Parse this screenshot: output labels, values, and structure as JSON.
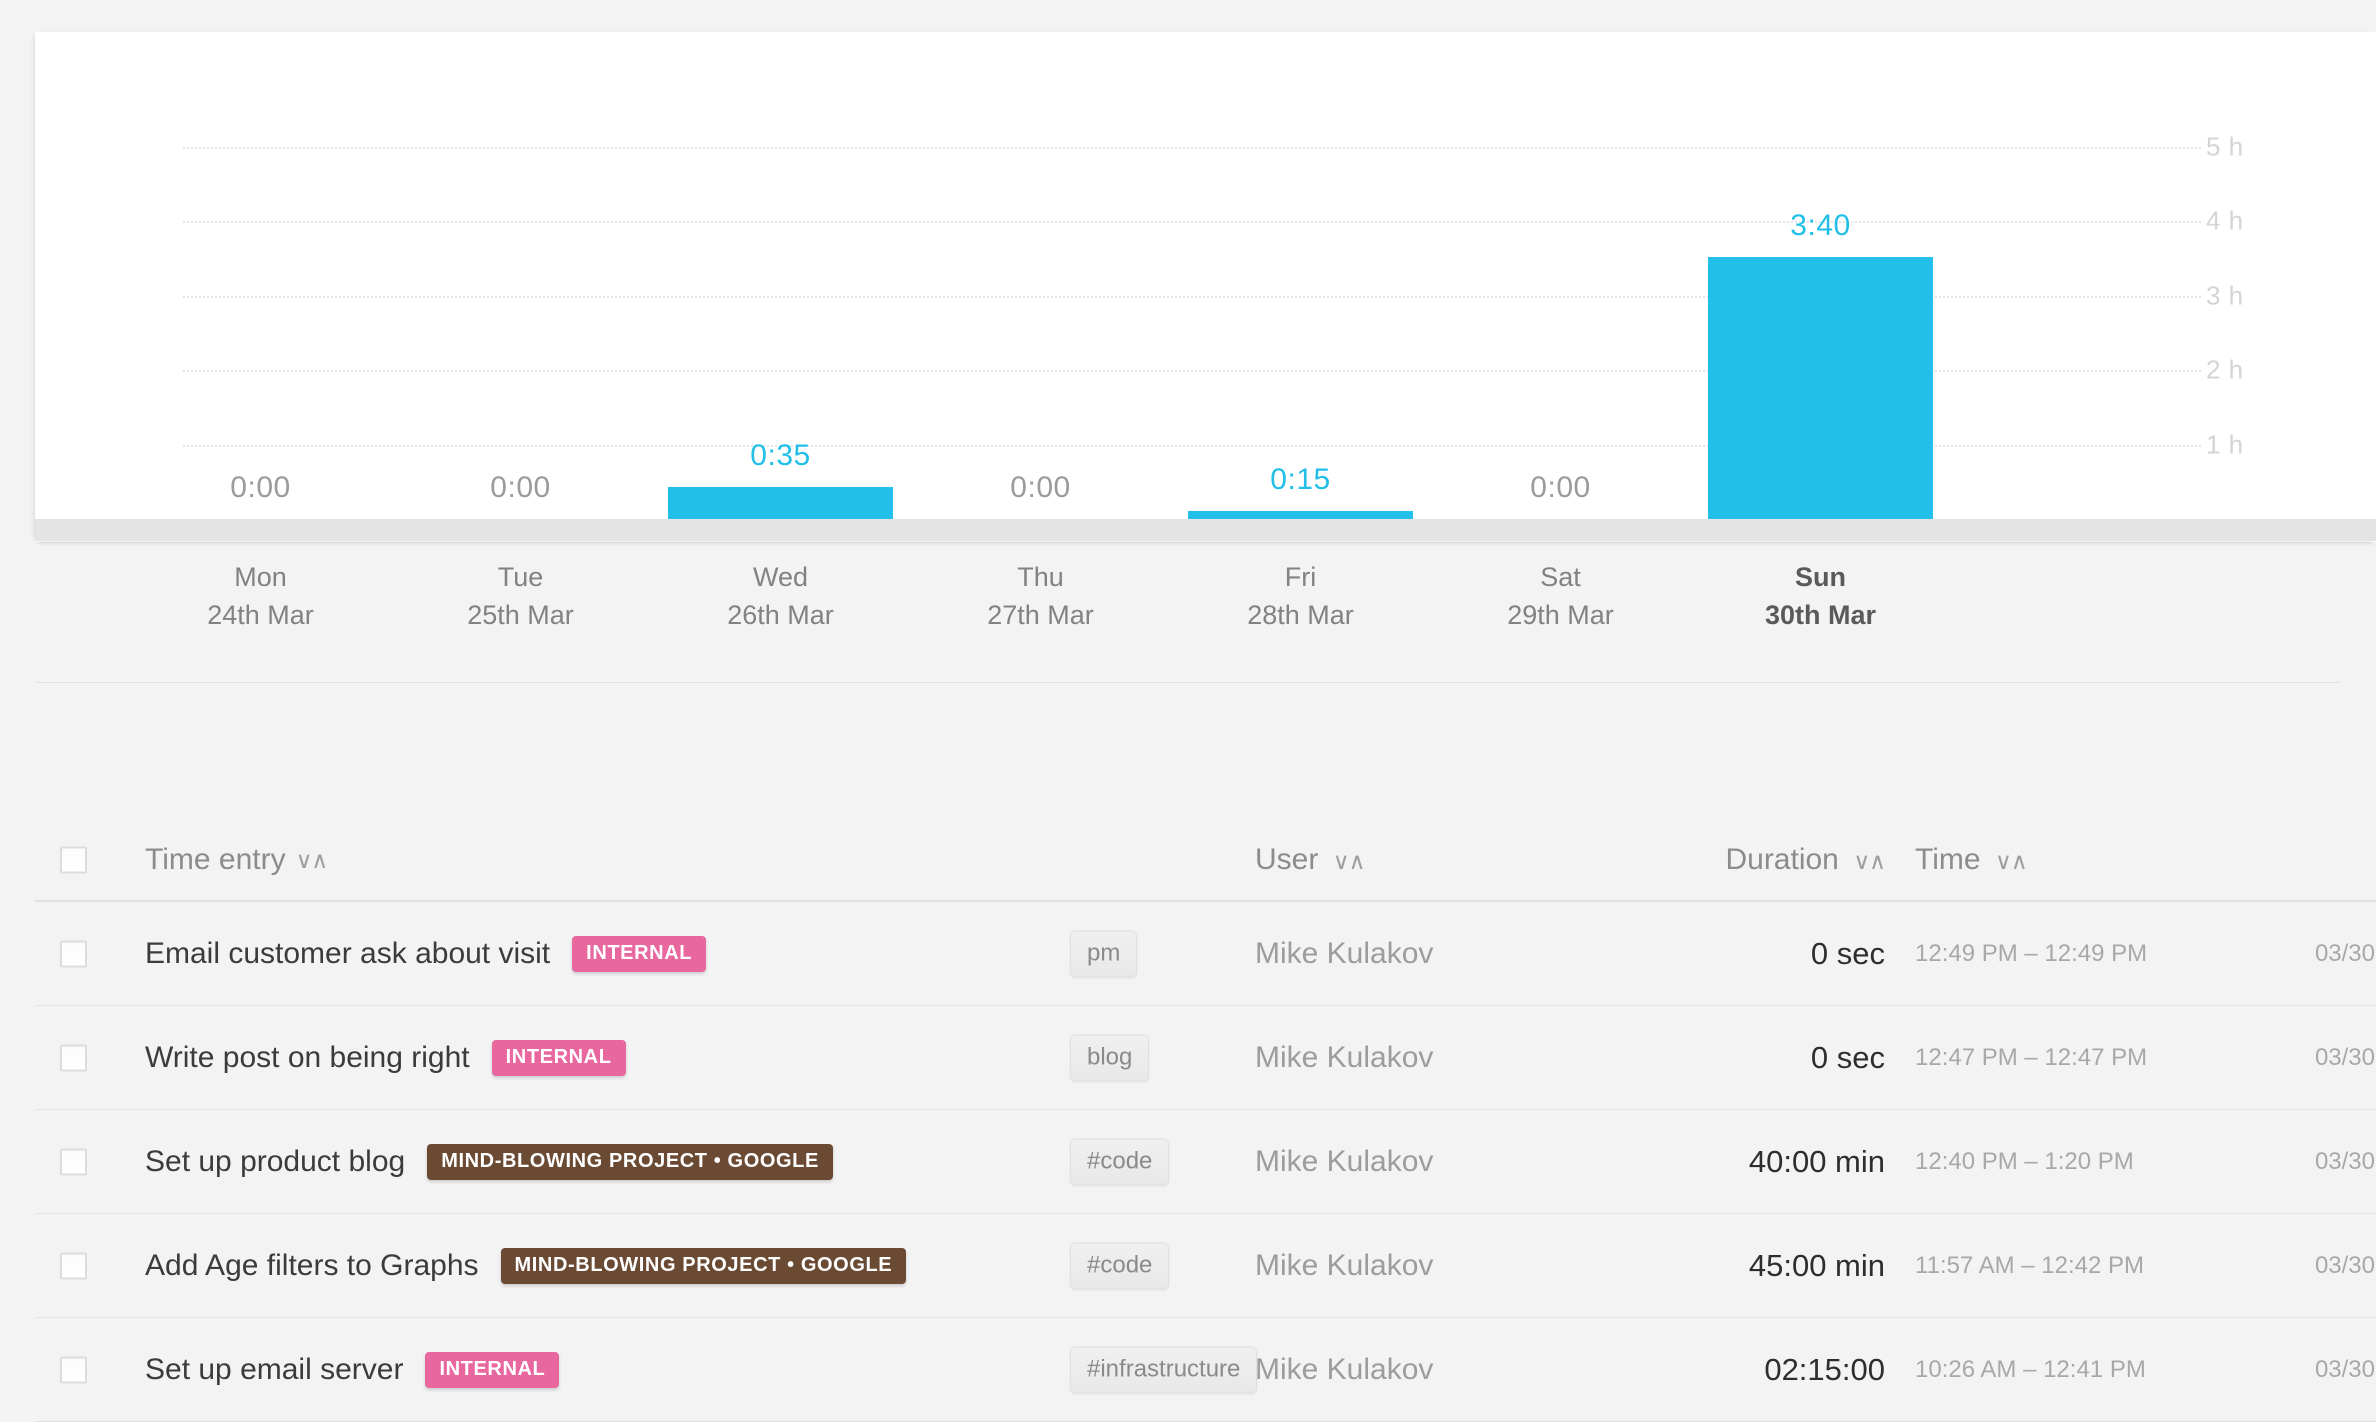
{
  "colors": {
    "accent": "#22bfe8",
    "zero_bar": "#8e8e8e",
    "internal_badge": "#e9679f",
    "project_badge": "#6b4a34",
    "page_bg": "#f3f3f3",
    "card_bg": "#ffffff"
  },
  "chart_data": {
    "type": "bar",
    "title": "",
    "xlabel": "",
    "ylabel": "",
    "ylim": [
      0,
      5.5
    ],
    "grid": true,
    "legend_position": "none",
    "y_ticks": [
      1,
      2,
      3,
      4,
      5
    ],
    "y_tick_labels": [
      "1 h",
      "2 h",
      "3 h",
      "4 h",
      "5 h"
    ],
    "categories": [
      "Mon",
      "Tue",
      "Wed",
      "Thu",
      "Fri",
      "Sat",
      "Sun"
    ],
    "category_dates": [
      "24th Mar",
      "25th Mar",
      "26th Mar",
      "27th Mar",
      "28th Mar",
      "29th Mar",
      "30th Mar"
    ],
    "data_labels": [
      "0:00",
      "0:00",
      "0:35",
      "0:00",
      "0:15",
      "0:00",
      "3:40"
    ],
    "values": [
      0,
      0,
      0.583,
      0,
      0.25,
      0,
      3.667
    ],
    "bar_states": [
      "zero",
      "zero",
      "filled",
      "zero",
      "filled",
      "zero",
      "filled"
    ],
    "highlighted_category": "Sun"
  },
  "table": {
    "columns": [
      {
        "key": "entry",
        "label": "Time entry",
        "sort": "∨∧"
      },
      {
        "key": "user",
        "label": "User",
        "sort": "∨∧"
      },
      {
        "key": "duration",
        "label": "Duration",
        "sort": "∨∧"
      },
      {
        "key": "time",
        "label": "Time",
        "sort": "∨∧"
      }
    ],
    "rows": [
      {
        "title": "Email customer ask about visit",
        "badge": "INTERNAL",
        "badge_kind": "internal",
        "tag": "pm",
        "user": "Mike Kulakov",
        "duration": "0 sec",
        "time": "12:49 PM – 12:49 PM",
        "date": "03/30"
      },
      {
        "title": "Write post on being right",
        "badge": "INTERNAL",
        "badge_kind": "internal",
        "tag": "blog",
        "user": "Mike Kulakov",
        "duration": "0 sec",
        "time": "12:47 PM – 12:47 PM",
        "date": "03/30"
      },
      {
        "title": "Set up product blog",
        "badge": "MIND-BLOWING PROJECT  •  GOOGLE",
        "badge_kind": "project",
        "tag": "#code",
        "user": "Mike Kulakov",
        "duration": "40:00 min",
        "time": "12:40 PM – 1:20 PM",
        "date": "03/30"
      },
      {
        "title": "Add Age filters to Graphs",
        "badge": "MIND-BLOWING PROJECT  •  GOOGLE",
        "badge_kind": "project",
        "tag": "#code",
        "user": "Mike Kulakov",
        "duration": "45:00 min",
        "time": "11:57 AM – 12:42 PM",
        "date": "03/30"
      },
      {
        "title": "Set up email server",
        "badge": "INTERNAL",
        "badge_kind": "internal",
        "tag": "#infrastructure",
        "user": "Mike Kulakov",
        "duration": "02:15:00",
        "time": "10:26 AM – 12:41 PM",
        "date": "03/30"
      }
    ]
  }
}
